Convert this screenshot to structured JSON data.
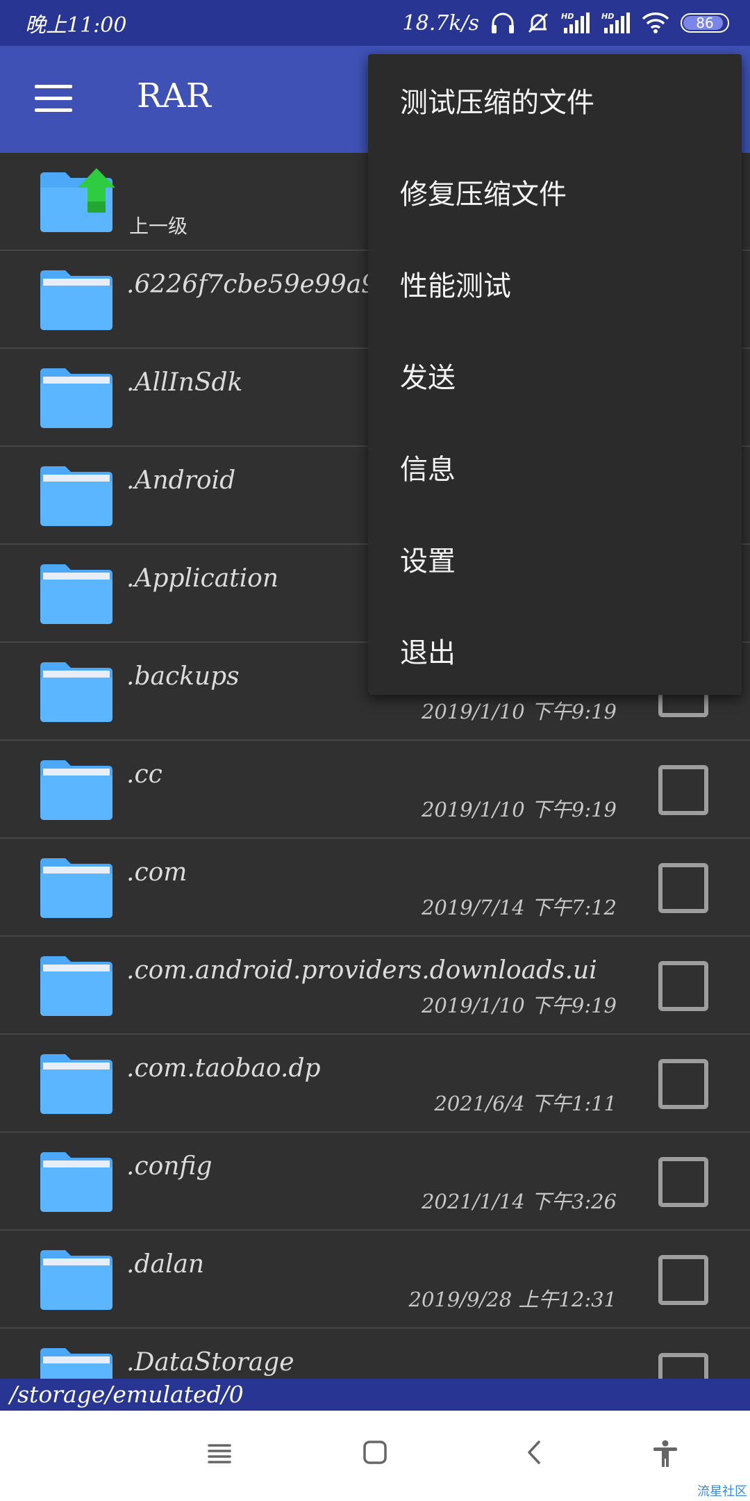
{
  "status_bar": {
    "time": "晚上11:00",
    "speed": "18.7k/s",
    "battery": "86",
    "battery_level": 86,
    "icons": [
      "headphones-icon",
      "mute-bell-icon",
      "hd-signal-icon",
      "hd-signal-icon",
      "wifi-icon",
      "battery-icon"
    ]
  },
  "app_bar": {
    "title": "RAR",
    "menu_icon": "hamburger-menu-icon"
  },
  "colors": {
    "status_bar": "#283593",
    "app_bar": "#3f51b5",
    "background": "#303030",
    "folder": "#4ea8f8",
    "up_arrow": "#2ecc40"
  },
  "overflow_menu": {
    "items": [
      {
        "label": "测试压缩的文件"
      },
      {
        "label": "修复压缩文件"
      },
      {
        "label": "性能测试"
      },
      {
        "label": "发送"
      },
      {
        "label": "信息"
      },
      {
        "label": "设置"
      },
      {
        "label": "退出"
      }
    ]
  },
  "file_list": {
    "up_label": "上一级",
    "rows": [
      {
        "name": ".6226f7cbe59e99a9",
        "date": ""
      },
      {
        "name": ".AllInSdk",
        "date": ""
      },
      {
        "name": ".Android",
        "date": ""
      },
      {
        "name": ".Application",
        "date": ""
      },
      {
        "name": ".backups",
        "date": "2019/1/10 下午9:19"
      },
      {
        "name": ".cc",
        "date": "2019/1/10 下午9:19"
      },
      {
        "name": ".com",
        "date": "2019/7/14 下午7:12"
      },
      {
        "name": ".com.android.providers.downloads.ui",
        "date": "2019/1/10 下午9:19"
      },
      {
        "name": ".com.taobao.dp",
        "date": "2021/6/4 下午1:11"
      },
      {
        "name": ".config",
        "date": "2021/1/14 下午3:26"
      },
      {
        "name": ".dalan",
        "date": "2019/9/28 上午12:31"
      },
      {
        "name": ".DataStorage",
        "date": ""
      }
    ]
  },
  "path_bar": {
    "path": "/storage/emulated/0"
  },
  "nav_bar": {
    "buttons": [
      "recents-icon",
      "home-icon",
      "back-icon",
      "accessibility-icon"
    ]
  },
  "watermark": "流星社区"
}
